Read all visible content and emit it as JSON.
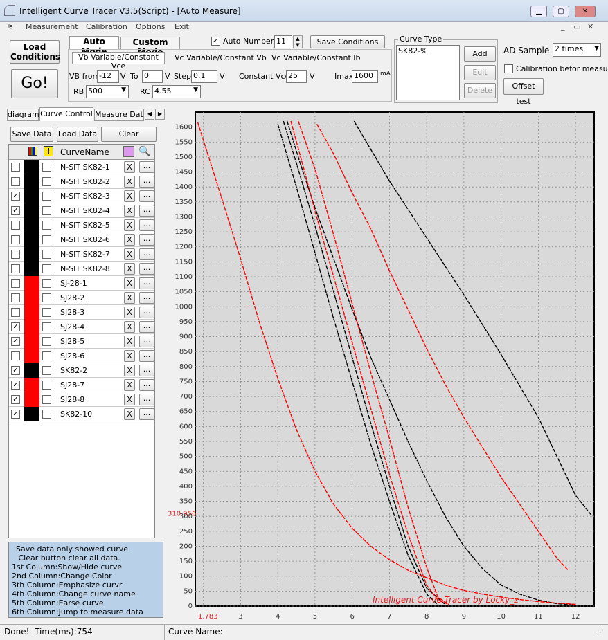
{
  "window": {
    "title": "Intelligent Curve Tracer V3.5(Script) - [Auto Measure]"
  },
  "menu": [
    "Measurement",
    "Calibration",
    "Options",
    "Exit"
  ],
  "toolbar": {
    "load_conditions": [
      "Load",
      "Conditions"
    ],
    "go": "Go!",
    "mode_tabs": [
      "Auto Mode",
      "Custom Mode"
    ],
    "sub_tabs": [
      "Vb Variable/Constant Vce",
      "Vc Variable/Constant Vb",
      "Vc Variable/Constant Ib"
    ],
    "auto_number_label": "Auto Number",
    "auto_number_value": "11",
    "save_conditions": "Save Conditions",
    "vb_from_label": "VB from",
    "vb_from_value": "-12",
    "v_unit": "V",
    "to_label": "To",
    "to_value": "0",
    "step_label": "Step",
    "step_value": "0.1",
    "constant_vce_label": "Constant Vce",
    "constant_vce_value": "25",
    "imax_label": "Imax",
    "imax_value": "1600",
    "imax_unit": "mA",
    "rb_label": "RB",
    "rb_value": "500",
    "rc_label": "RC",
    "rc_value": "4.55",
    "curve_type_label": "Curve Type",
    "curve_type_item": "SK82-%",
    "add": "Add",
    "edit": "Edit",
    "delete": "Delete",
    "ad_sample_label": "AD Sample",
    "ad_sample_value": "2 times",
    "calibration_label": "Calibration befor measure",
    "offset_test": "Offset test"
  },
  "left_tabs": [
    "diagram",
    "Curve Control",
    "Measure Data"
  ],
  "left_buttons": [
    "Save Data",
    "Load Data",
    "Clear"
  ],
  "table": {
    "header": "CurveName",
    "rows": [
      {
        "name": "N-SIT SK82-1",
        "show": false,
        "color": "#000000"
      },
      {
        "name": "N-SIT SK82-2",
        "show": false,
        "color": "#000000"
      },
      {
        "name": "N-SIT SK82-3",
        "show": true,
        "color": "#000000"
      },
      {
        "name": "N-SIT SK82-4",
        "show": true,
        "color": "#000000"
      },
      {
        "name": "N-SIT SK82-5",
        "show": false,
        "color": "#000000"
      },
      {
        "name": "N-SIT SK82-6",
        "show": false,
        "color": "#000000"
      },
      {
        "name": "N-SIT SK82-7",
        "show": false,
        "color": "#000000"
      },
      {
        "name": "N-SIT SK82-8",
        "show": false,
        "color": "#000000"
      },
      {
        "name": "SJ-28-1",
        "show": false,
        "color": "#ff0000"
      },
      {
        "name": "SJ28-2",
        "show": false,
        "color": "#ff0000"
      },
      {
        "name": "SJ28-3",
        "show": false,
        "color": "#ff0000"
      },
      {
        "name": "SJ28-4",
        "show": true,
        "color": "#ff0000"
      },
      {
        "name": "SJ28-5",
        "show": true,
        "color": "#ff0000"
      },
      {
        "name": "SJ28-6",
        "show": false,
        "color": "#ff0000"
      },
      {
        "name": "SK82-2",
        "show": true,
        "color": "#000000"
      },
      {
        "name": "SJ28-7",
        "show": true,
        "color": "#ff0000"
      },
      {
        "name": "SJ28-8",
        "show": true,
        "color": "#ff0000"
      },
      {
        "name": "SK82-10",
        "show": true,
        "color": "#000000"
      }
    ],
    "erase_label": "X",
    "jump_label": "..."
  },
  "help_text": [
    "Save data only showed curve",
    " Clear button clear all data.",
    "1st Column:Show/Hide curve",
    "2nd Column:Change Color",
    "3th Column:Emphasize curvr",
    "4th Column:Change curve name",
    "5th Column:Earse curve",
    "6th Column:Jump to measure data"
  ],
  "status": {
    "left": "Done!  Time(ms):754",
    "right": "Curve Name:"
  },
  "chart_data": {
    "type": "line",
    "xlim": [
      1.783,
      12.5
    ],
    "ylim": [
      0,
      1650
    ],
    "xticks": [
      2,
      3,
      4,
      5,
      6,
      7,
      8,
      9,
      10,
      11,
      12
    ],
    "xtick_labels": [
      "",
      "3",
      "4",
      "5",
      "6",
      "7",
      "8",
      "9",
      "10",
      "11",
      "12"
    ],
    "x_min_label": "1.783",
    "yticks": [
      0,
      50,
      100,
      150,
      200,
      250,
      300,
      350,
      400,
      450,
      500,
      550,
      600,
      650,
      700,
      750,
      800,
      850,
      900,
      950,
      1000,
      1050,
      1100,
      1150,
      1200,
      1250,
      1300,
      1350,
      1400,
      1450,
      1500,
      1550,
      1600
    ],
    "y_marker_label": "310.956",
    "y_marker_value": 310.956,
    "watermark": "Intelligent Curve Tracer by Locky_z",
    "grid": true,
    "series": [
      {
        "color": "#000000",
        "points": [
          [
            4.0,
            1610
          ],
          [
            4.5,
            1400
          ],
          [
            5,
            1180
          ],
          [
            5.5,
            960
          ],
          [
            6,
            750
          ],
          [
            6.5,
            540
          ],
          [
            7,
            350
          ],
          [
            7.5,
            170
          ],
          [
            8,
            40
          ],
          [
            8.3,
            5
          ]
        ]
      },
      {
        "color": "#000000",
        "points": [
          [
            4.15,
            1620
          ],
          [
            4.5,
            1480
          ],
          [
            5,
            1270
          ],
          [
            5.5,
            1050
          ],
          [
            6,
            830
          ],
          [
            6.5,
            610
          ],
          [
            7,
            400
          ],
          [
            7.5,
            200
          ],
          [
            8,
            60
          ],
          [
            8.5,
            5
          ]
        ]
      },
      {
        "color": "#000000",
        "points": [
          [
            4.25,
            1620
          ],
          [
            4.6,
            1480
          ],
          [
            5,
            1330
          ],
          [
            5.5,
            1160
          ],
          [
            6,
            990
          ],
          [
            6.5,
            830
          ],
          [
            7,
            690
          ],
          [
            7.5,
            550
          ],
          [
            8,
            420
          ],
          [
            8.5,
            300
          ],
          [
            9,
            200
          ],
          [
            9.5,
            125
          ],
          [
            10,
            70
          ],
          [
            10.5,
            40
          ],
          [
            11,
            20
          ],
          [
            11.5,
            8
          ],
          [
            12,
            3
          ]
        ]
      },
      {
        "color": "#000000",
        "points": [
          [
            6.05,
            1620
          ],
          [
            7,
            1420
          ],
          [
            8,
            1230
          ],
          [
            9,
            1040
          ],
          [
            10,
            840
          ],
          [
            11,
            630
          ],
          [
            11.5,
            500
          ],
          [
            12,
            370
          ],
          [
            12.45,
            300
          ]
        ]
      },
      {
        "color": "#ff0000",
        "points": [
          [
            1.85,
            1615
          ],
          [
            2.5,
            1360
          ],
          [
            3,
            1160
          ],
          [
            3.5,
            950
          ],
          [
            4,
            760
          ],
          [
            4.5,
            590
          ],
          [
            5,
            450
          ],
          [
            5.5,
            340
          ],
          [
            6,
            260
          ],
          [
            6.5,
            200
          ],
          [
            7,
            155
          ],
          [
            7.5,
            120
          ],
          [
            8,
            95
          ],
          [
            8.5,
            70
          ],
          [
            9,
            52
          ],
          [
            9.5,
            40
          ],
          [
            10,
            30
          ],
          [
            10.5,
            22
          ],
          [
            11,
            15
          ],
          [
            11.5,
            10
          ],
          [
            12,
            6
          ]
        ]
      },
      {
        "color": "#ff0000",
        "points": [
          [
            4.35,
            1620
          ],
          [
            4.7,
            1460
          ],
          [
            5,
            1320
          ],
          [
            5.5,
            1100
          ],
          [
            6,
            880
          ],
          [
            6.5,
            660
          ],
          [
            7,
            440
          ],
          [
            7.5,
            240
          ],
          [
            8,
            70
          ],
          [
            8.3,
            20
          ],
          [
            8.6,
            5
          ]
        ]
      },
      {
        "color": "#ff0000",
        "points": [
          [
            4.55,
            1620
          ],
          [
            5,
            1460
          ],
          [
            5.5,
            1240
          ],
          [
            6,
            1010
          ],
          [
            6.5,
            780
          ],
          [
            7,
            560
          ],
          [
            7.5,
            330
          ],
          [
            8,
            130
          ],
          [
            8.3,
            30
          ],
          [
            8.6,
            5
          ]
        ]
      },
      {
        "color": "#ff0000",
        "points": [
          [
            5.05,
            1610
          ],
          [
            5.5,
            1510
          ],
          [
            6,
            1380
          ],
          [
            6.5,
            1260
          ],
          [
            7,
            1120
          ],
          [
            7.5,
            990
          ],
          [
            8,
            860
          ],
          [
            8.5,
            740
          ],
          [
            9,
            630
          ],
          [
            9.5,
            530
          ],
          [
            10,
            430
          ],
          [
            10.5,
            340
          ],
          [
            11,
            250
          ],
          [
            11.5,
            160
          ],
          [
            11.8,
            120
          ]
        ]
      }
    ]
  }
}
